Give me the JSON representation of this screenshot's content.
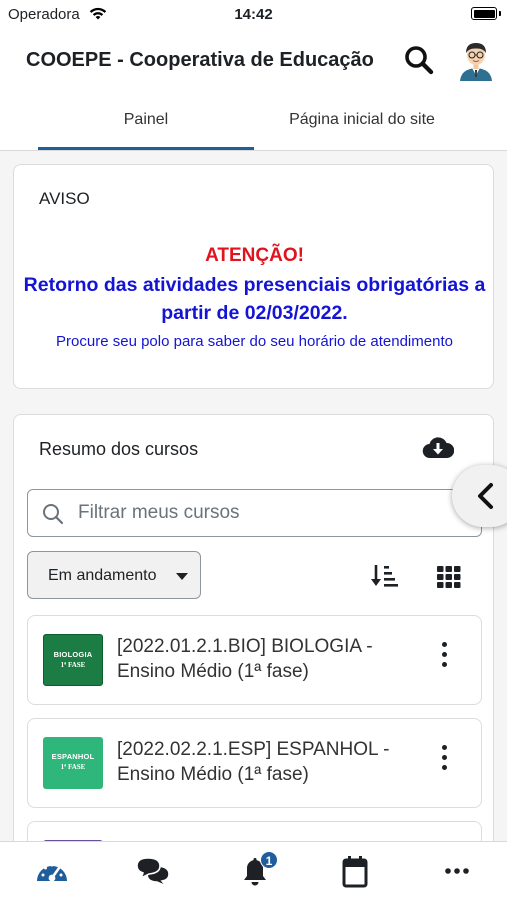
{
  "status_bar": {
    "carrier": "Operadora",
    "time": "14:42"
  },
  "header": {
    "title": "COOEPE - Cooperativa de Educação",
    "search_icon": "search-icon",
    "avatar_icon": "user-avatar"
  },
  "tabs": [
    {
      "label": "Painel",
      "active": true
    },
    {
      "label": "Página inicial do site",
      "active": false
    }
  ],
  "notice": {
    "heading": "AVISO",
    "alert": "ATENÇÃO!",
    "main": "Retorno das atividades presenciais obrigatórias a partir de 02/03/2022.",
    "sub": "Procure seu polo para saber do seu horário de atendimento",
    "colors": {
      "alert": "#e0141e",
      "main": "#1414d4"
    }
  },
  "courses": {
    "title": "Resumo dos cursos",
    "filter_placeholder": "Filtrar meus cursos",
    "status_filter": "Em andamento",
    "items": [
      {
        "name": "[2022.01.2.1.BIO] BIOLOGIA - Ensino Médio (1ª fase)",
        "image_label": "BIOLOGIA",
        "image_phase": "1ª FASE",
        "color": "#1c7d44"
      },
      {
        "name": "[2022.02.2.1.ESP] ESPANHOL - Ensino Médio (1ª fase)",
        "image_label": "ESPANHOL",
        "image_phase": "1ª FASE",
        "color": "#2fb67a"
      },
      {
        "name": "",
        "image_label": "",
        "image_phase": "",
        "color": "#6b4f9a"
      }
    ]
  },
  "bottom_nav": {
    "items": [
      "dashboard-icon",
      "messages-icon",
      "notifications-icon",
      "calendar-icon",
      "more-icon"
    ],
    "notifications_badge": "1"
  },
  "colors": {
    "accent": "#1f5d9b"
  }
}
